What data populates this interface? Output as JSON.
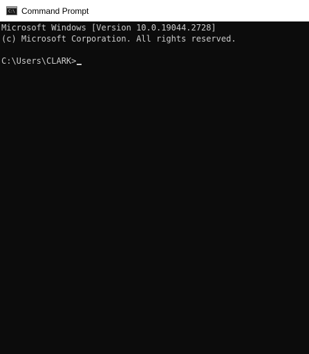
{
  "window": {
    "title": "Command Prompt",
    "icon": "cmd-icon",
    "icon_glyph": "C:\\"
  },
  "console": {
    "lines": [
      "Microsoft Windows [Version 10.0.19044.2728]",
      "(c) Microsoft Corporation. All rights reserved."
    ],
    "prompt": "C:\\Users\\CLARK>",
    "input_value": "",
    "colors": {
      "background": "#0c0c0c",
      "text": "#cccccc",
      "titlebar": "#ffffff"
    }
  }
}
